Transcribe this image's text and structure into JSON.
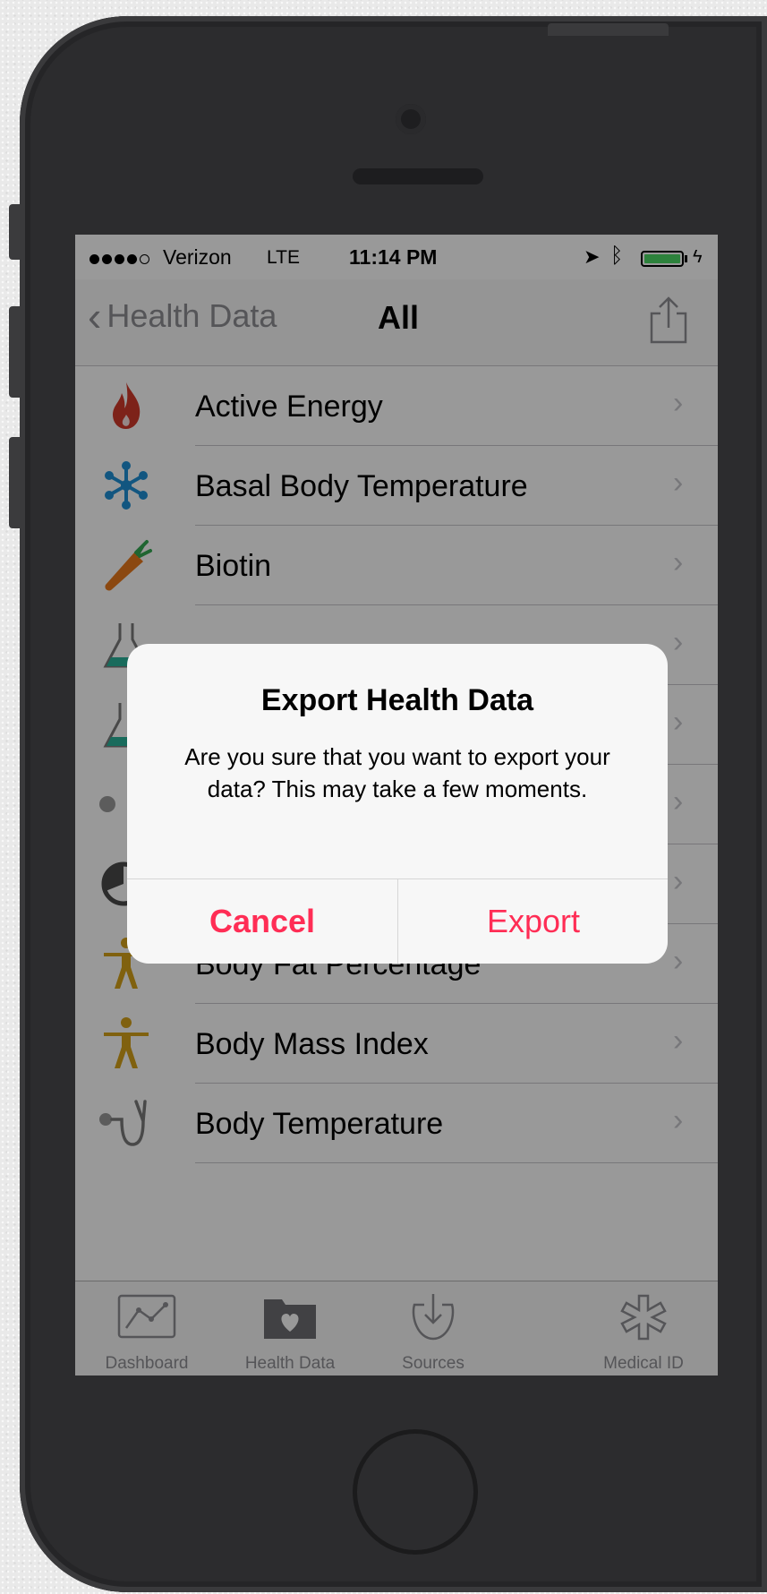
{
  "status": {
    "carrier": "Verizon",
    "network": "LTE",
    "time": "11:14 PM",
    "location_icon": "location-arrow-icon",
    "bluetooth_icon": "bluetooth-icon",
    "battery_level": 1.0,
    "charging_icon": "charging-bolt-icon"
  },
  "nav": {
    "back_label": "Health Data",
    "title": "All",
    "share_icon": "share-icon"
  },
  "list": {
    "items": [
      {
        "label": "Active Energy",
        "icon": "flame-icon"
      },
      {
        "label": "Basal Body Temperature",
        "icon": "snowflake-icon"
      },
      {
        "label": "Biotin",
        "icon": "carrot-icon"
      },
      {
        "label": "",
        "icon": "flask-icon"
      },
      {
        "label": "",
        "icon": "flask-icon"
      },
      {
        "label": "",
        "icon": "drops-icon"
      },
      {
        "label": "",
        "icon": "ring-icon"
      },
      {
        "label": "Body Fat Percentage",
        "icon": "person-icon"
      },
      {
        "label": "Body Mass Index",
        "icon": "person-icon"
      },
      {
        "label": "Body Temperature",
        "icon": "stethoscope-icon"
      }
    ]
  },
  "tabs": [
    {
      "label": "Dashboard",
      "icon": "dashboard-chart-icon"
    },
    {
      "label": "Health Data",
      "icon": "health-data-folder-icon"
    },
    {
      "label": "Sources",
      "icon": "sources-download-icon"
    },
    {
      "label": "Medical ID",
      "icon": "medical-id-asterisk-icon"
    }
  ],
  "alert": {
    "title": "Export Health Data",
    "message": "Are you sure that you want to export your data? This may take a few moments.",
    "cancel_label": "Cancel",
    "export_label": "Export"
  },
  "colors": {
    "accent": "#ff2d55",
    "battery": "#4cd964",
    "flame": "#d0392b",
    "snowflake": "#1e90d6",
    "carrot": "#e8791c",
    "person": "#d6a21a"
  }
}
